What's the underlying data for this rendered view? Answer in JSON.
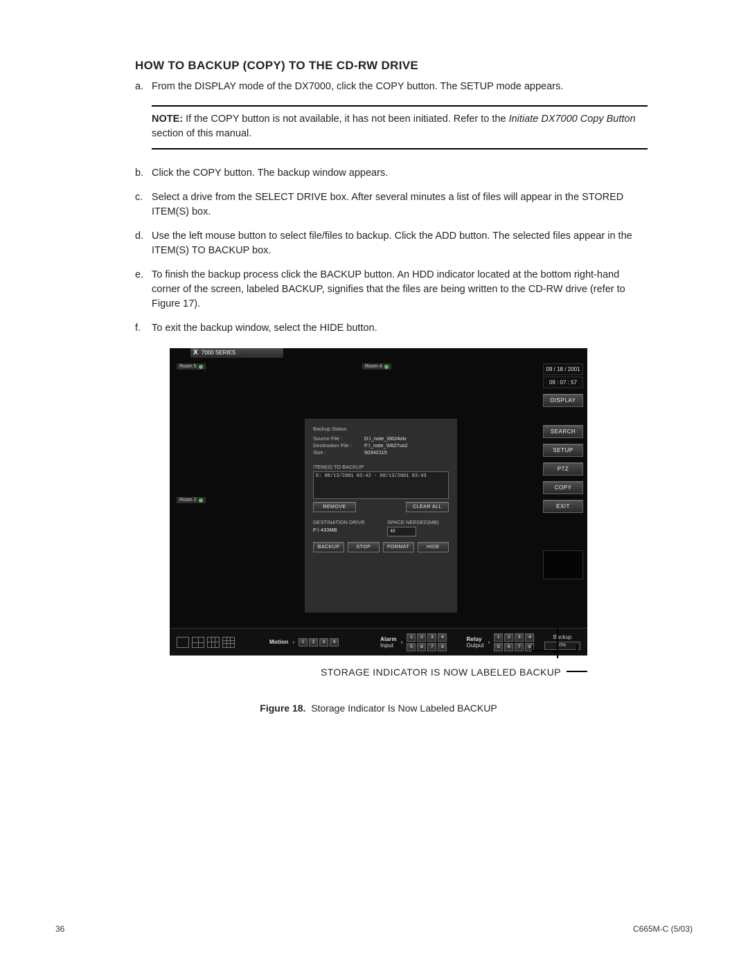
{
  "section_title": "HOW TO BACKUP (COPY) TO THE CD-RW DRIVE",
  "steps": {
    "a": "From the DISPLAY mode of the DX7000, click the COPY button. The SETUP mode appears.",
    "b": "Click the COPY button. The backup window appears.",
    "c": "Select a drive from the SELECT DRIVE box. After several minutes a list of files will appear in the STORED ITEM(S) box.",
    "d": "Use the left mouse button to select file/files to backup. Click the ADD button. The selected files appear in the ITEM(S) TO BACKUP box.",
    "e": "To finish the backup process click the BACKUP button. An HDD indicator located at the bottom right-hand corner of the screen, labeled BACKUP, signifies that the files are being written to the CD-RW drive (refer to Figure 17).",
    "f": "To exit the backup window, select the HIDE button."
  },
  "note": {
    "label": "NOTE:",
    "text_before_italic": "If the COPY button is not available, it has not been initiated. Refer to the ",
    "italic": "Initiate DX7000 Copy Button",
    "text_after_italic": " section of this manual."
  },
  "screenshot": {
    "titlebar": "7000 SERIES",
    "titlebar_x": "X",
    "cameras": {
      "c1": "Room 5",
      "c2": "Room 4",
      "c3": "Room 2"
    },
    "date": "09 / 18 / 2001",
    "time": "09 : 07 : 57",
    "right_buttons": {
      "display": "DISPLAY",
      "search": "SEARCH",
      "setup": "SETUP",
      "ptz": "PTZ",
      "copy": "COPY",
      "exit": "EXIT"
    },
    "dialog": {
      "status_label": "Backup Status",
      "source_k": "Source File :",
      "source_v": "D:\\_note_\\0624olv",
      "dest_k": "Destination File :",
      "dest_v": "F:\\_note_\\0627us2",
      "size_k": "Size :",
      "size_v": "50342115",
      "items_label": "ITEM(S) TO BACKUP",
      "item_line": "D: 08/13/2001 03:42 - 08/13/2001 03:43",
      "btn_remove": "REMOVE",
      "btn_clear": "CLEAR ALL",
      "destdrive_label": "DESTINATION DRIVE",
      "destdrive_value": "F:\\ 433MB",
      "space_label": "SPACE NEEDED(MB)",
      "space_value": "48",
      "btn_backup": "BACKUP",
      "btn_stop": "STOP",
      "btn_format": "FORMAT",
      "btn_hide": "HIDE"
    },
    "bottom": {
      "motion_label": "Motion",
      "motion_chips": [
        "1",
        "2",
        "3",
        "4"
      ],
      "alarm_label": "Alarm",
      "input_label": "Input",
      "alarm_chips": [
        "1",
        "2",
        "3",
        "4",
        "5",
        "6",
        "7",
        "8"
      ],
      "relay_label": "Relay",
      "output_label": "Output",
      "relay_chips": [
        "1",
        "2",
        "3",
        "4",
        "5",
        "6",
        "7",
        "8"
      ],
      "backup_label": "Backup",
      "backup_pct": "0%"
    }
  },
  "callout": "STORAGE INDICATOR IS NOW LABELED BACKUP",
  "figure": {
    "label": "Figure 18.",
    "text": "Storage Indicator Is Now Labeled BACKUP"
  },
  "footer": {
    "page": "36",
    "docid": "C665M-C (5/03)"
  }
}
